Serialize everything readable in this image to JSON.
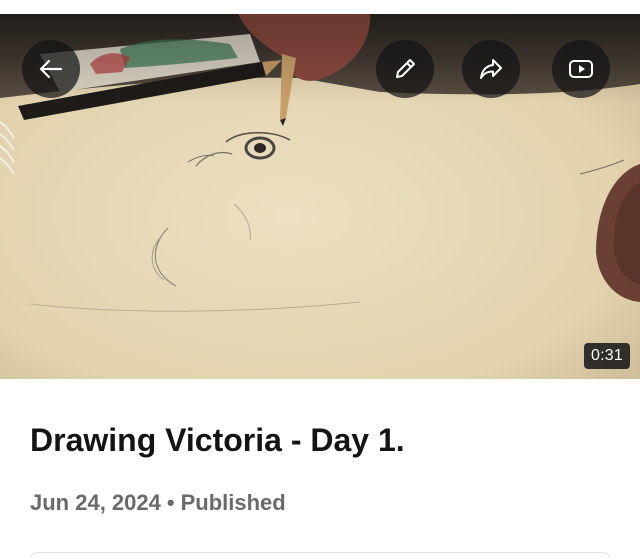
{
  "video": {
    "duration": "0:31"
  },
  "toolbar": {
    "back_icon": "arrow-left-icon",
    "edit_icon": "pencil-icon",
    "share_icon": "share-arrow-icon",
    "youtube_icon": "youtube-play-icon"
  },
  "details": {
    "title": "Drawing Victoria - Day 1.",
    "date": "Jun 24, 2024",
    "separator": "•",
    "status": "Published"
  },
  "colors": {
    "overlay_button": "#141414",
    "title": "#141414",
    "meta": "#6a6a6a",
    "paper": "#e6d7b4"
  }
}
